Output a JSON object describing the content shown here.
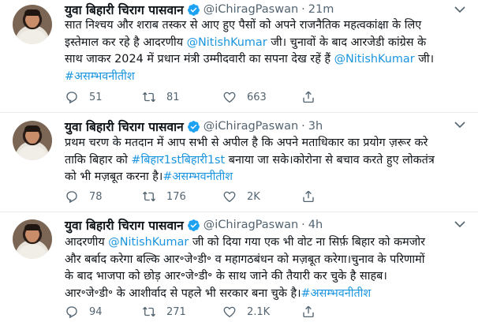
{
  "tweets": [
    {
      "author": {
        "name": "युवा बिहारी चिराग पासवान",
        "handle": "@iChiragPaswan",
        "verified": true
      },
      "time": "21m",
      "lines": [
        [
          {
            "t": "सात निश्चय और शराब तस्कर से आए हुए पैसों को अपने राजनैतिक महत्वकांक्षा के लिए"
          }
        ],
        [
          {
            "t": "इस्तेमाल कर रहे है आदरणीय "
          },
          {
            "t": "@NitishKumar",
            "link": true
          },
          {
            "t": " जी। चुनावों के बाद आरजेडी कांग्रेस के"
          }
        ],
        [
          {
            "t": "साथ जाकर 2024 में प्रधान मंत्री उम्मीदवारी का सपना देख रहें हैं "
          },
          {
            "t": "@NitishKumar",
            "link": true
          },
          {
            "t": " जी।"
          }
        ],
        [
          {
            "t": "#असम्भवनीतीश",
            "link": true
          }
        ]
      ],
      "replies": "51",
      "retweets": "81",
      "likes": "663"
    },
    {
      "author": {
        "name": "युवा बिहारी चिराग पासवान",
        "handle": "@iChiragPaswan",
        "verified": true
      },
      "time": "3h",
      "lines": [
        [
          {
            "t": "प्रथम चरण के मतदान में आप सभी से अपील है कि अपने मताधिकार का प्रयोग ज़रूर करे"
          }
        ],
        [
          {
            "t": "ताकि बिहार को "
          },
          {
            "t": "#बिहार1stबिहारी1st",
            "link": true
          },
          {
            "t": " बनाया जा सके।कोरोना से बचाव करते हुए लोकतंत्र"
          }
        ],
        [
          {
            "t": "को भी मज़बूत करना है।"
          },
          {
            "t": "#असम्भवनीतीश",
            "link": true
          }
        ]
      ],
      "replies": "78",
      "retweets": "176",
      "likes": "2K"
    },
    {
      "author": {
        "name": "युवा बिहारी चिराग पासवान",
        "handle": "@iChiragPaswan",
        "verified": true
      },
      "time": "4h",
      "lines": [
        [
          {
            "t": "आदरणीय "
          },
          {
            "t": "@NitishKumar",
            "link": true
          },
          {
            "t": " जी को दिया गया एक भी वोट ना सिर्फ़ बिहार को कमजोर"
          }
        ],
        [
          {
            "t": "और बर्बाद करेगा बल्कि आर॰जे॰डी॰ व महागठबंधन को मज़बूत करेगा।चुनाव के परिणामों"
          }
        ],
        [
          {
            "t": "के बाद भाजपा को छोड़ आर॰जे॰डी॰ के साथ जाने की तैयारी कर चुके है साहब।"
          }
        ],
        [
          {
            "t": "आर॰जे॰डी॰ के आशीर्वाद से पहले भी सरकार बना चुके है।"
          },
          {
            "t": "#असम्भवनीतीश",
            "link": true
          }
        ]
      ],
      "replies": "94",
      "retweets": "271",
      "likes": "2.1K"
    }
  ],
  "colors": {
    "link": "#1b95e0",
    "verified": "#1da1f2",
    "muted": "#536471",
    "divider": "#e6ecf0"
  },
  "icons": [
    "verified-badge-icon",
    "chevron-down-icon",
    "reply-icon",
    "retweet-icon",
    "like-icon",
    "share-icon"
  ]
}
